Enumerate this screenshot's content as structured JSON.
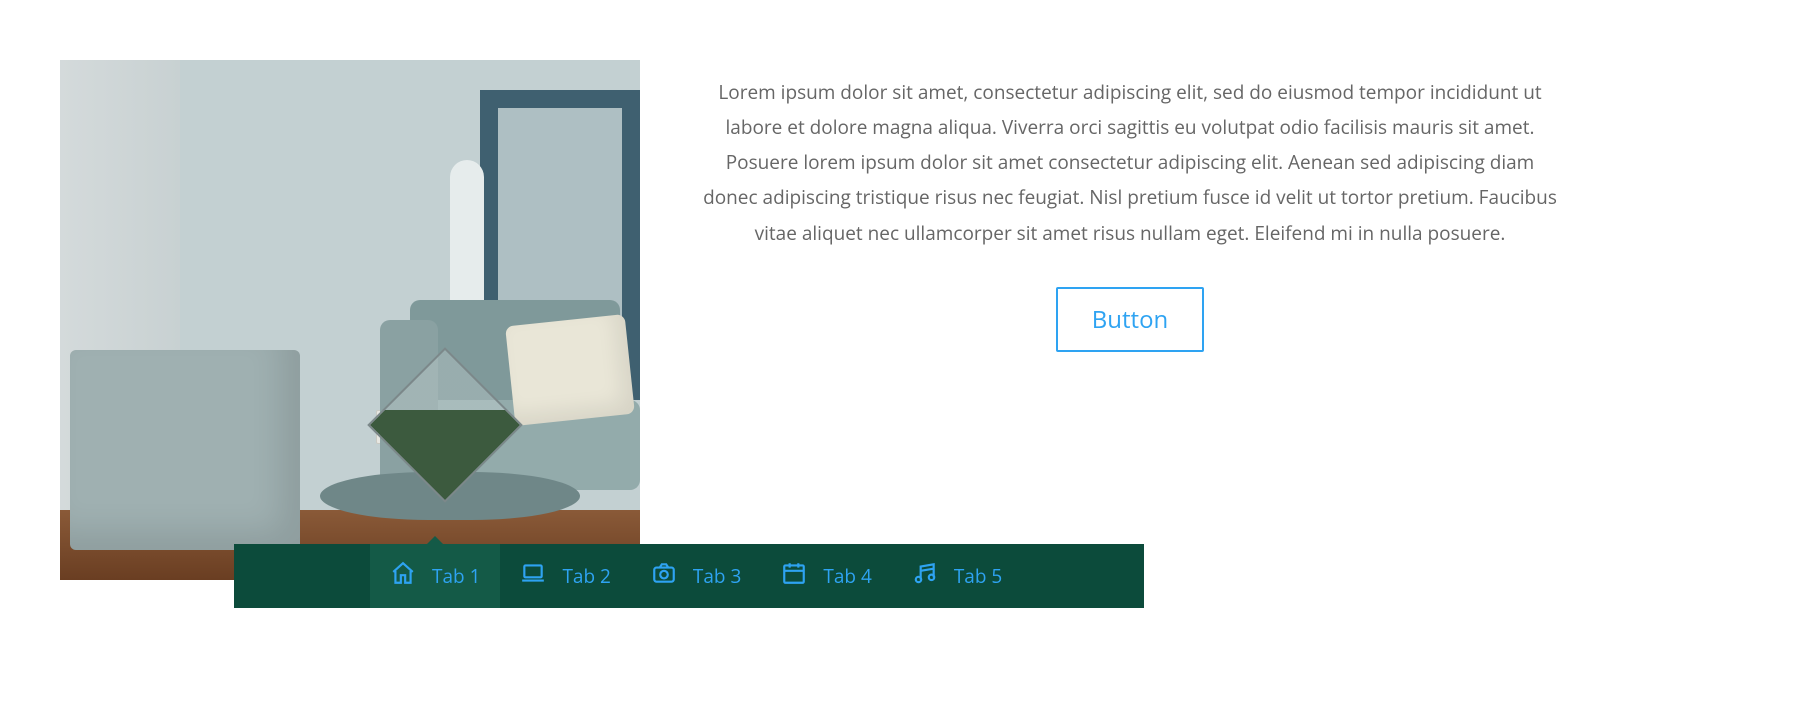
{
  "content": {
    "paragraph": "Lorem ipsum dolor sit amet, consectetur adipiscing elit, sed do eiusmod tempor incididunt ut labore et dolore magna aliqua. Viverra orci sagittis eu volutpat odio facilisis mauris sit amet. Posuere lorem ipsum dolor sit amet consectetur adipiscing elit. Aenean sed adipiscing diam donec adipiscing tristique risus nec feugiat. Nisl pretium fusce id velit ut tortor pretium. Faucibus vitae aliquet nec ullamcorper sit amet risus nullam eget. Eleifend mi in nulla posuere.",
    "button_label": "Button"
  },
  "tabs": [
    {
      "label": "Tab 1",
      "icon": "home-icon",
      "active": true
    },
    {
      "label": "Tab 2",
      "icon": "laptop-icon",
      "active": false
    },
    {
      "label": "Tab 3",
      "icon": "camera-icon",
      "active": false
    },
    {
      "label": "Tab 4",
      "icon": "calendar-icon",
      "active": false
    },
    {
      "label": "Tab 5",
      "icon": "music-icon",
      "active": false
    }
  ],
  "colors": {
    "accent": "#2ea3f2",
    "tab_bar_bg": "#0c4b3b",
    "tab_active_bg": "#145a47",
    "body_text": "#666666"
  }
}
